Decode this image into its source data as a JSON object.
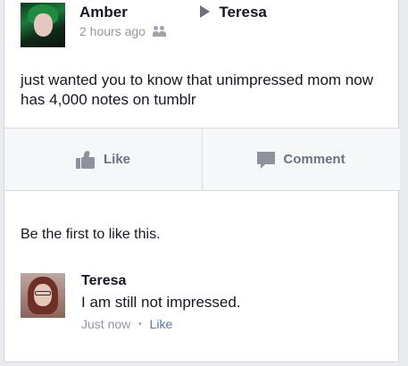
{
  "post": {
    "author": "Amber",
    "target": "Teresa",
    "timestamp": "2 hours ago",
    "audience_icon": "friends-icon",
    "text": "just wanted you to know that unimpressed mom now has 4,000 notes on tumblr"
  },
  "actions": {
    "like_label": "Like",
    "comment_label": "Comment"
  },
  "likes_summary": "Be the first to like this.",
  "comment": {
    "author": "Teresa",
    "text": "I am still not impressed.",
    "timestamp": "Just now",
    "like_label": "Like"
  },
  "colors": {
    "meta_grey": "#9197a3",
    "action_grey": "#6a7180",
    "link_blue": "#5b74a8"
  }
}
